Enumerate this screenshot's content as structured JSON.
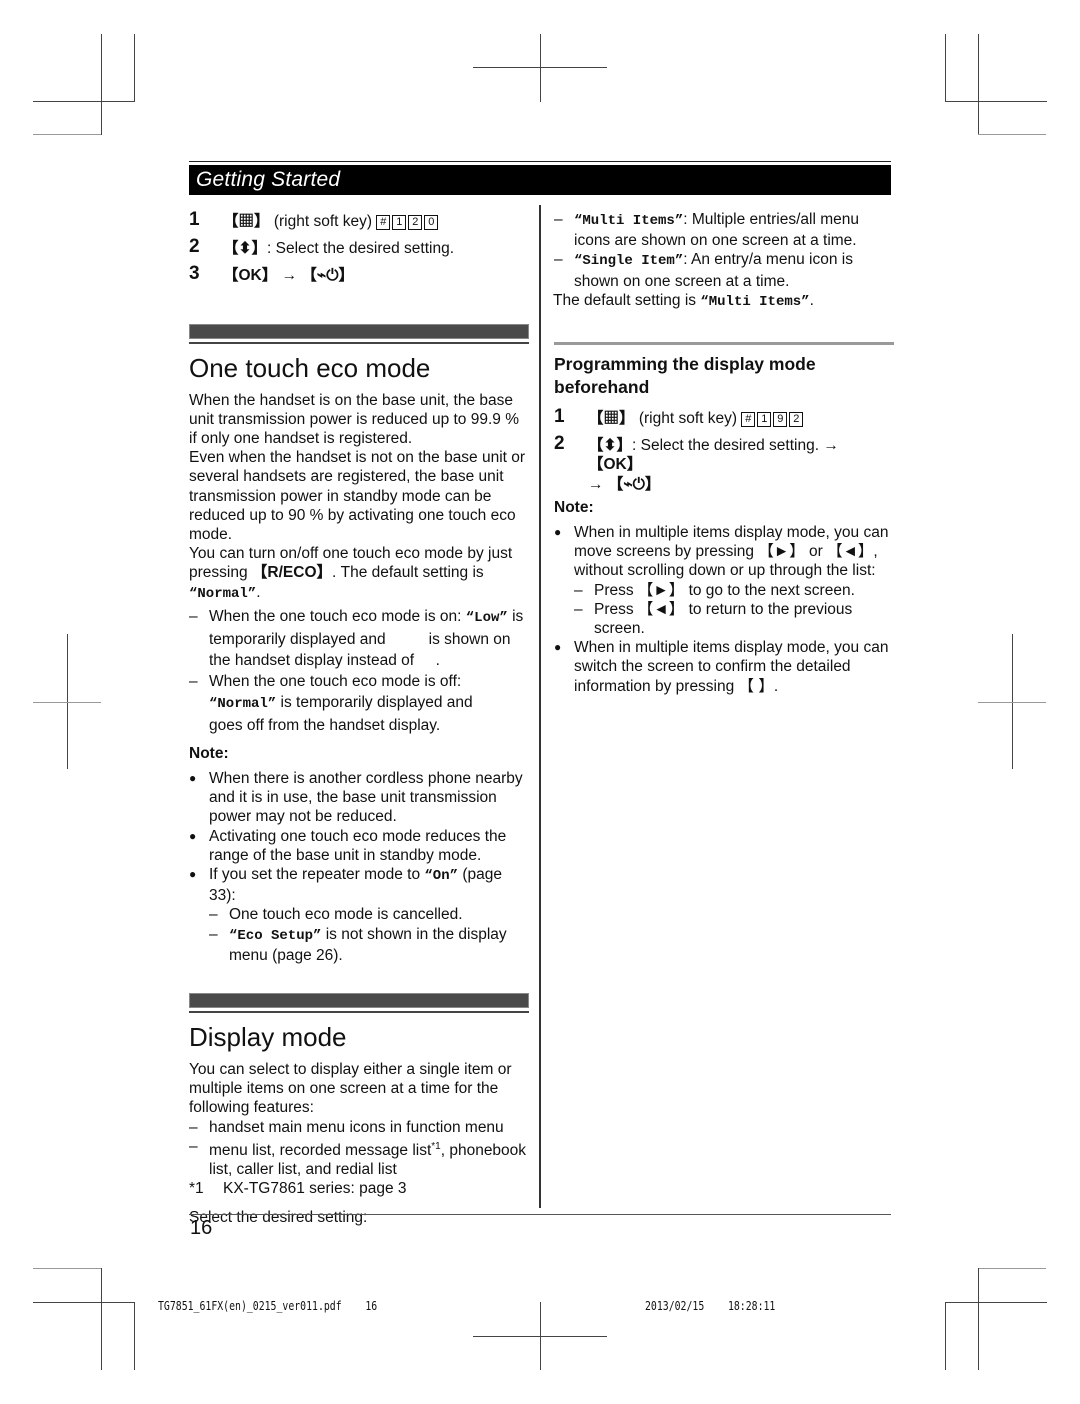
{
  "header": {
    "section": "Getting Started"
  },
  "left": {
    "steps_top": [
      {
        "num": "1",
        "pre": "【",
        "icon": "menu-icon",
        "post": "】",
        "text": " (right soft key) ",
        "keys": [
          "#",
          "1",
          "2",
          "0"
        ]
      },
      {
        "num": "2",
        "pre": "【",
        "icon": "up-down-icon",
        "post": "】",
        "text": ": Select the desired setting."
      },
      {
        "num": "3",
        "ok": "【OK】",
        "arrow": "→",
        "off": "【⌁⏻】"
      }
    ],
    "eco": {
      "title": "One touch eco mode",
      "para1": "When the handset is on the base unit, the base unit transmission power is reduced up to 99.9 % if only one handset is registered.",
      "para2": "Even when the handset is not on the base unit or several handsets are registered, the base unit transmission power in standby mode can be reduced up to 90 % by activating one touch eco mode.",
      "para3_a": "You can turn on/off one touch eco mode by just pressing ",
      "para3_key": "【R/ECO】",
      "para3_b": ". The default setting is ",
      "para3_val": "“Normal”",
      "para3_c": ".",
      "dash1_a": "When the one touch eco mode is on: ",
      "dash1_val": "“Low”",
      "dash1_b": " is temporarily displayed and          is shown on the handset display instead of     .",
      "dash2_a": "When the one touch eco mode is off: ",
      "dash2_val": "“Normal”",
      "dash2_b": " is temporarily displayed and          goes off from the handset display.",
      "note_label": "Note:",
      "notes": [
        "When there is another cordless phone nearby and it is in use, the base unit transmission power may not be reduced.",
        "Activating one touch eco mode reduces the range of the base unit in standby mode."
      ],
      "note3_a": "If you set the repeater mode to ",
      "note3_val": "“On”",
      "note3_b": " (page 33):",
      "note3_sub1": "One touch eco mode is cancelled.",
      "note3_sub2_val": "“Eco Setup”",
      "note3_sub2_b": " is not shown in the display menu (page 26)."
    },
    "display": {
      "title": "Display mode",
      "intro": "You can select to display either a single item or multiple items on one screen at a time for the following features:",
      "item1": "handset main menu icons in function menu",
      "item2_a": "menu list, recorded message list",
      "item2_sup": "*1",
      "item2_b": ", phonebook list, caller list, and redial list",
      "footnote_mark": "*1",
      "footnote_text": "KX-TG7861 series: page 3",
      "select": "Select the desired setting:"
    }
  },
  "right": {
    "opt1_val": "“Multi Items”",
    "opt1_text": ": Multiple entries/all menu icons are shown on one screen at a time.",
    "opt2_val": "“Single Item”",
    "opt2_text": ": An entry/a menu icon is shown on one screen at a time.",
    "default_a": "The default setting is ",
    "default_val": "“Multi Items”",
    "default_b": ".",
    "sub_title": "Programming the display mode beforehand",
    "steps": [
      {
        "num": "1",
        "text": " (right soft key) ",
        "keys": [
          "#",
          "1",
          "9",
          "2"
        ]
      },
      {
        "num": "2",
        "text": ": Select the desired setting. ",
        "arrow": "→",
        "ok": "【OK】",
        "off": "【⌁⏻】"
      }
    ],
    "note_label": "Note:",
    "note1": "When in multiple items display mode, you can move screens by pressing 【►】 or 【◄】, without scrolling down or up through the list:",
    "note1_sub1": "Press 【►】 to go to the next screen.",
    "note1_sub2": "Press 【◄】 to return to the previous screen.",
    "note2": "When in multiple items display mode, you can switch the screen to confirm the detailed information by pressing 【      】."
  },
  "footer": {
    "page_number": "16",
    "file_name": "TG7851_61FX(en)_0215_ver011.pdf",
    "file_page": "16",
    "date": "2013/02/15",
    "time": "18:28:11"
  }
}
